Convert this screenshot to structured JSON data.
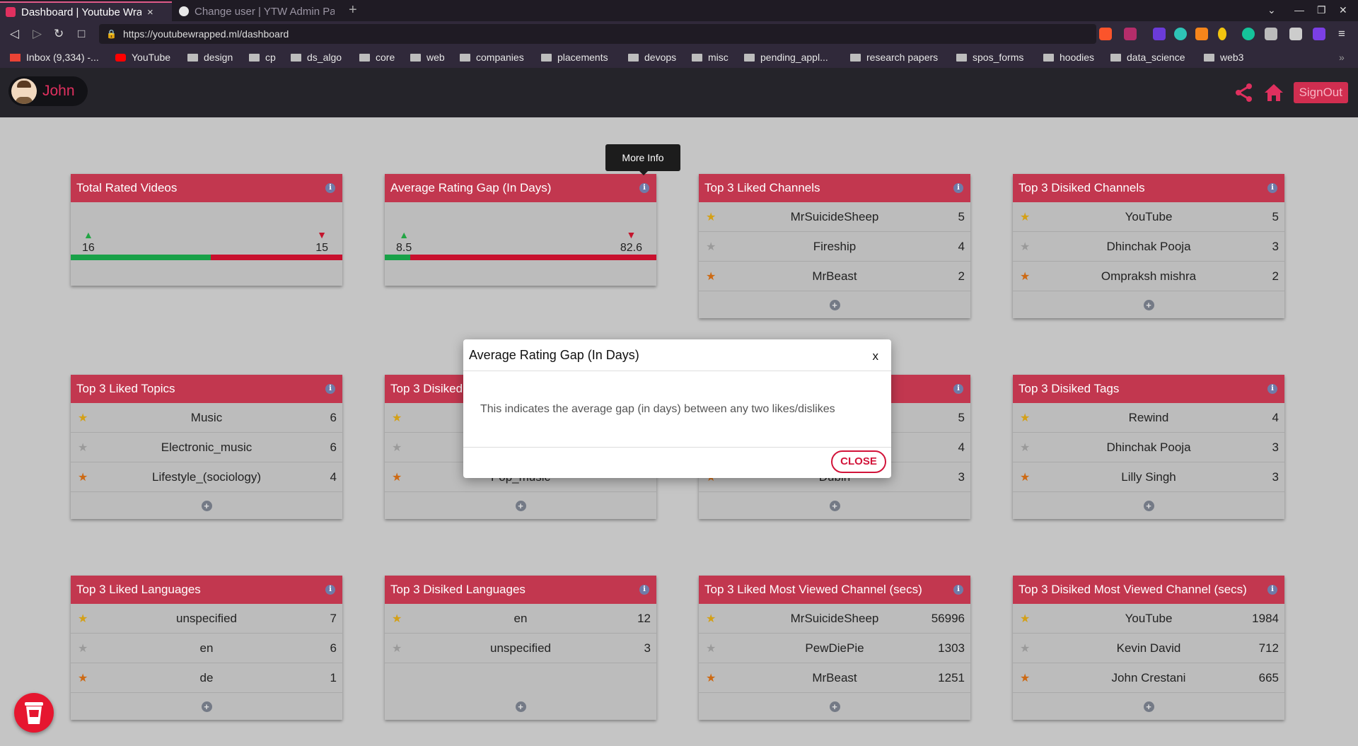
{
  "browser": {
    "tabs": [
      {
        "title": "Dashboard | Youtube Wra",
        "close": "×"
      },
      {
        "title": "Change user | YTW Admin Pa"
      }
    ],
    "new_tab": "+",
    "url": "https://youtubewrapped.ml/dashboard",
    "bookmarks": [
      "Inbox (9,334) -...",
      "YouTube",
      "design",
      "cp",
      "ds_algo",
      "core",
      "web",
      "companies",
      "placements",
      "devops",
      "misc",
      "pending_appl...",
      "research papers",
      "spos_forms",
      "hoodies",
      "data_science",
      "web3"
    ],
    "bookmarks_overflow": "»"
  },
  "navbar": {
    "user_name": "John",
    "signout_label": "SignOut",
    "accent": "#e0305f"
  },
  "tooltip": "More Info",
  "stats": {
    "total_rated": {
      "title": "Total Rated Videos",
      "likes": "16",
      "dislikes": "15",
      "like_fraction": 0.516
    },
    "avg_gap": {
      "title": "Average Rating Gap (In Days)",
      "likes": "8.5",
      "dislikes": "82.6",
      "like_fraction": 0.093
    }
  },
  "lists": [
    {
      "title": "Top 3 Liked Channels",
      "rows": [
        {
          "name": "MrSuicideSheep",
          "count": "5"
        },
        {
          "name": "Fireship",
          "count": "4"
        },
        {
          "name": "MrBeast",
          "count": "2"
        }
      ]
    },
    {
      "title": "Top 3 Disiked Channels",
      "rows": [
        {
          "name": "YouTube",
          "count": "5"
        },
        {
          "name": "Dhinchak Pooja",
          "count": "3"
        },
        {
          "name": "Ompraksh mishra",
          "count": "2"
        }
      ]
    },
    {
      "title": "Top 3 Liked Topics",
      "rows": [
        {
          "name": "Music",
          "count": "6"
        },
        {
          "name": "Electronic_music",
          "count": "6"
        },
        {
          "name": "Lifestyle_(sociology)",
          "count": "4"
        }
      ]
    },
    {
      "title": "Top 3 Disiked",
      "rows": [
        {
          "name": "",
          "count": ""
        },
        {
          "name": "",
          "count": ""
        },
        {
          "name": "Pop_music",
          "count": ""
        }
      ]
    },
    {
      "title": "",
      "rows": [
        {
          "name": "",
          "count": "5"
        },
        {
          "name": "",
          "count": "4"
        },
        {
          "name": "Dubin",
          "count": "3"
        }
      ]
    },
    {
      "title": "Top 3 Disiked Tags",
      "rows": [
        {
          "name": "Rewind",
          "count": "4"
        },
        {
          "name": "Dhinchak Pooja",
          "count": "3"
        },
        {
          "name": "Lilly Singh",
          "count": "3"
        }
      ]
    },
    {
      "title": "Top 3 Liked Languages",
      "rows": [
        {
          "name": "unspecified",
          "count": "7"
        },
        {
          "name": "en",
          "count": "6"
        },
        {
          "name": "de",
          "count": "1"
        }
      ]
    },
    {
      "title": "Top 3 Disiked Languages",
      "rows": [
        {
          "name": "en",
          "count": "12"
        },
        {
          "name": "unspecified",
          "count": "3"
        }
      ]
    },
    {
      "title": "Top 3 Liked Most Viewed Channel (secs)",
      "rows": [
        {
          "name": "MrSuicideSheep",
          "count": "56996"
        },
        {
          "name": "PewDiePie",
          "count": "1303"
        },
        {
          "name": "MrBeast",
          "count": "1251"
        }
      ]
    },
    {
      "title": "Top 3 Disiked Most Viewed Channel (secs)",
      "rows": [
        {
          "name": "YouTube",
          "count": "1984"
        },
        {
          "name": "Kevin David",
          "count": "712"
        },
        {
          "name": "John Crestani",
          "count": "665"
        }
      ]
    }
  ],
  "modal": {
    "title": "Average Rating Gap (In Days)",
    "close_x": "x",
    "body": "This indicates the average gap (in days) between any two likes/dislikes",
    "close_label": "CLOSE"
  }
}
